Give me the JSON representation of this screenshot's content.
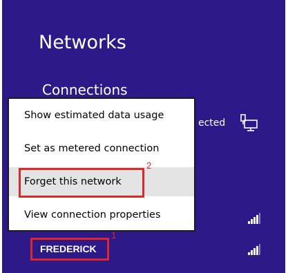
{
  "panel": {
    "title": "Networks",
    "section_heading": "Connections",
    "connections": [
      {
        "status": "ected",
        "icon": "wired-network-icon"
      }
    ],
    "networks": [
      {
        "name": "FREDERICK",
        "icon": "wifi-signal-icon"
      }
    ]
  },
  "context_menu": {
    "items": [
      {
        "label": "Show estimated data usage"
      },
      {
        "label": "Set as metered connection"
      },
      {
        "label": "Forget this network",
        "highlighted": true
      },
      {
        "label": "View connection properties"
      }
    ]
  },
  "annotations": [
    {
      "number": "1",
      "target": "FREDERICK"
    },
    {
      "number": "2",
      "target": "Forget this network"
    }
  ],
  "colors": {
    "panel_background": "#2e1989",
    "annotation_red": "#e0252b",
    "menu_highlight": "#e4e4e4"
  }
}
